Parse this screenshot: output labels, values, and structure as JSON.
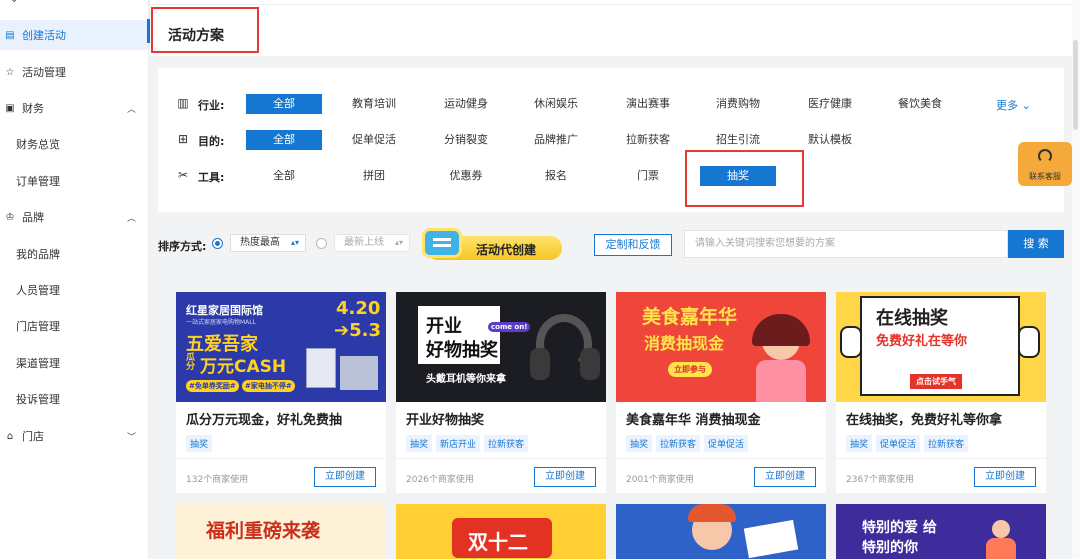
{
  "sidebar": {
    "items": [
      {
        "label": "创建活动",
        "icon": "document-icon"
      },
      {
        "label": "活动管理",
        "icon": "star-icon"
      },
      {
        "label": "财务",
        "icon": "calendar-icon"
      },
      {
        "label": "财务总览"
      },
      {
        "label": "订单管理"
      },
      {
        "label": "品牌",
        "icon": "crown-icon"
      },
      {
        "label": "我的品牌"
      },
      {
        "label": "人员管理"
      },
      {
        "label": "门店管理"
      },
      {
        "label": "渠道管理"
      },
      {
        "label": "投诉管理"
      },
      {
        "label": "门店",
        "icon": "store-icon"
      }
    ]
  },
  "header": {
    "title": "活动方案"
  },
  "filters": {
    "industry": {
      "label": "行业:",
      "options": [
        "全部",
        "教育培训",
        "运动健身",
        "休闲娱乐",
        "演出赛事",
        "消费购物",
        "医疗健康",
        "餐饮美食"
      ],
      "more": "更多"
    },
    "purpose": {
      "label": "目的:",
      "options": [
        "全部",
        "促单促活",
        "分销裂变",
        "品牌推广",
        "拉新获客",
        "招生引流",
        "默认模板"
      ]
    },
    "tool": {
      "label": "工具:",
      "options": [
        "全部",
        "拼团",
        "优惠券",
        "报名",
        "门票",
        "抽奖"
      ]
    }
  },
  "sort": {
    "label": "排序方式:",
    "hottest": "热度最高",
    "newest": "最新上线",
    "proxy_create": "活动代创建",
    "custom_feedback": "定制和反馈",
    "search_placeholder": "请输入关键词搜索您想要的方案",
    "search_button": "搜 索"
  },
  "cards": [
    {
      "title": "瓜分万元现金，好礼免费抽",
      "tags": [
        "抽奖"
      ],
      "usage": "132个商家使用",
      "button": "立即创建",
      "banner": {
        "brand": "红星家居国际馆",
        "sub": "一站式家居家电购物MALL",
        "dates1": "4.20",
        "dates2": "➔5.3",
        "line1": "五爱吾家",
        "line2a": "瓜分",
        "line2b": "万元CASH",
        "pill1": "#免单券奖励#",
        "pill2": "#家电抽不停#"
      }
    },
    {
      "title": "开业好物抽奖",
      "tags": [
        "抽奖",
        "新店开业",
        "拉新获客"
      ],
      "usage": "2026个商家使用",
      "button": "立即创建",
      "banner": {
        "l1": "开业",
        "l2": "好物抽奖",
        "sub": "头戴耳机等你来拿",
        "bubble": "come on!"
      }
    },
    {
      "title": "美食嘉年华 消费抽现金",
      "tags": [
        "抽奖",
        "拉新获客",
        "促单促活"
      ],
      "usage": "2001个商家使用",
      "button": "立即创建",
      "banner": {
        "l1": "美食嘉年华",
        "l2": "消费抽现金",
        "btn": "立即参与"
      }
    },
    {
      "title": "在线抽奖，免费好礼等你拿",
      "tags": [
        "抽奖",
        "促单促活",
        "拉新获客"
      ],
      "usage": "2367个商家使用",
      "button": "立即创建",
      "banner": {
        "l1": "在线抽奖",
        "l2": "免费好礼在等你",
        "btn": "点击试手气"
      }
    }
  ],
  "row2": [
    {
      "text": "福利重磅来袭"
    },
    {
      "text": "双十二"
    },
    {
      "text": ""
    },
    {
      "text": "特别的爱 给特别的你"
    }
  ],
  "service": {
    "label": "联系客服"
  },
  "colors": {
    "primary": "#1677d2",
    "highlight": "#e53935",
    "proxy": "#f6c623"
  }
}
